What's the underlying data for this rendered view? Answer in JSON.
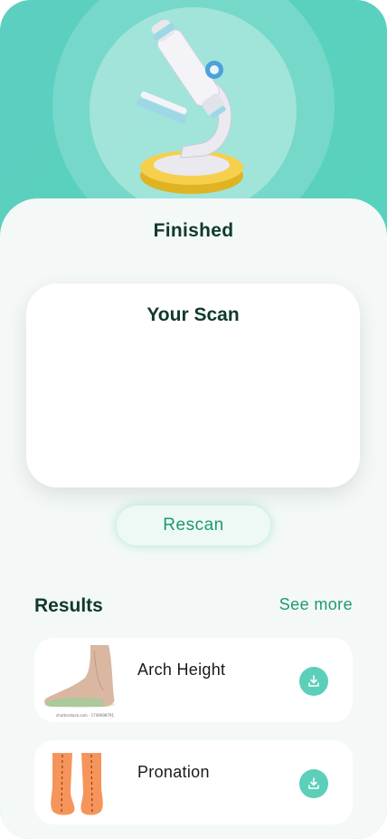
{
  "header": {
    "illustration": "microscope-illustration",
    "colors": {
      "gradient_start": "#5ccfc1",
      "gradient_end": "#61d6b8"
    }
  },
  "status": {
    "title": "Finished"
  },
  "scan": {
    "title": "Your Scan"
  },
  "actions": {
    "rescan_label": "Rescan"
  },
  "results": {
    "heading": "Results",
    "see_more_label": "See more",
    "items": [
      {
        "label": "Arch Height",
        "image": "foot-side-view",
        "caption": "shutterstock.com · 1749698791",
        "action_icon": "download-icon"
      },
      {
        "label": "Pronation",
        "image": "feet-rear-view",
        "action_icon": "download-icon"
      }
    ]
  },
  "theme": {
    "accent": "#1b9a74",
    "heading": "#0f3a2c",
    "background": "#f4f9f7"
  }
}
